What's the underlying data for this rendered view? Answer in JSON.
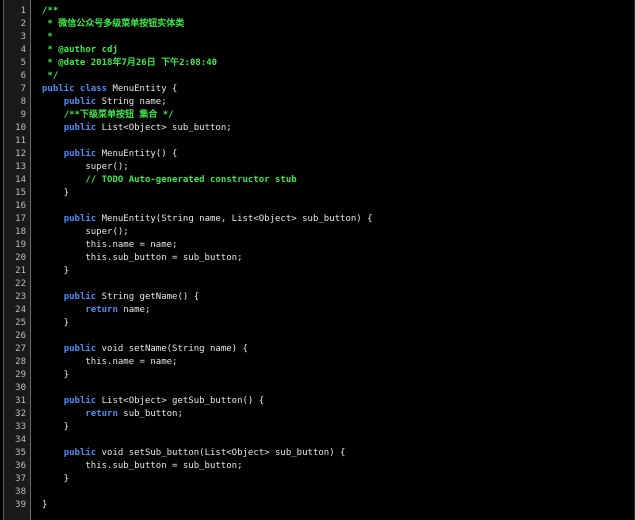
{
  "editor": {
    "language": "java",
    "colors": {
      "background": "#000000",
      "gutter": "#1a1a1a",
      "line_number": "#bdbdbd",
      "comment": "#3ee84a",
      "keyword": "#4b8cf5",
      "text": "#e6e6e6"
    },
    "lines": [
      {
        "n": "1",
        "segments": [
          [
            "c",
            "/**"
          ]
        ]
      },
      {
        "n": "2",
        "segments": [
          [
            "c",
            " * 微信公众号多级菜单按钮实体类"
          ]
        ]
      },
      {
        "n": "3",
        "segments": [
          [
            "c",
            " *"
          ]
        ]
      },
      {
        "n": "4",
        "segments": [
          [
            "c",
            " * @author cdj"
          ]
        ]
      },
      {
        "n": "5",
        "segments": [
          [
            "c",
            " * @date 2018年7月26日 下午2:08:40"
          ]
        ]
      },
      {
        "n": "6",
        "segments": [
          [
            "c",
            " */"
          ]
        ]
      },
      {
        "n": "7",
        "segments": [
          [
            "k",
            "public class"
          ],
          [
            "t",
            " MenuEntity {"
          ]
        ]
      },
      {
        "n": "8",
        "segments": [
          [
            "t",
            "    "
          ],
          [
            "k",
            "public"
          ],
          [
            "t",
            " String name;"
          ]
        ]
      },
      {
        "n": "9",
        "segments": [
          [
            "t",
            "    "
          ],
          [
            "c",
            "/**下级菜单按钮 集合 */"
          ]
        ]
      },
      {
        "n": "10",
        "segments": [
          [
            "t",
            "    "
          ],
          [
            "k",
            "public"
          ],
          [
            "t",
            " List<Object> sub_button;"
          ]
        ]
      },
      {
        "n": "11",
        "segments": []
      },
      {
        "n": "12",
        "segments": [
          [
            "t",
            "    "
          ],
          [
            "k",
            "public"
          ],
          [
            "t",
            " MenuEntity() {"
          ]
        ]
      },
      {
        "n": "13",
        "segments": [
          [
            "t",
            "        super();"
          ]
        ]
      },
      {
        "n": "14",
        "segments": [
          [
            "t",
            "        "
          ],
          [
            "c",
            "// TODO Auto-generated constructor stub"
          ]
        ]
      },
      {
        "n": "15",
        "segments": [
          [
            "t",
            "    }"
          ]
        ]
      },
      {
        "n": "16",
        "segments": []
      },
      {
        "n": "17",
        "segments": [
          [
            "t",
            "    "
          ],
          [
            "k",
            "public"
          ],
          [
            "t",
            " MenuEntity(String name, List<Object> sub_button) {"
          ]
        ]
      },
      {
        "n": "18",
        "segments": [
          [
            "t",
            "        super();"
          ]
        ]
      },
      {
        "n": "19",
        "segments": [
          [
            "t",
            "        this.name = name;"
          ]
        ]
      },
      {
        "n": "20",
        "segments": [
          [
            "t",
            "        this.sub_button = sub_button;"
          ]
        ]
      },
      {
        "n": "21",
        "segments": [
          [
            "t",
            "    }"
          ]
        ]
      },
      {
        "n": "22",
        "segments": []
      },
      {
        "n": "23",
        "segments": [
          [
            "t",
            "    "
          ],
          [
            "k",
            "public"
          ],
          [
            "t",
            " String getName() {"
          ]
        ]
      },
      {
        "n": "24",
        "segments": [
          [
            "t",
            "        "
          ],
          [
            "k",
            "return"
          ],
          [
            "t",
            " name;"
          ]
        ]
      },
      {
        "n": "25",
        "segments": [
          [
            "t",
            "    }"
          ]
        ]
      },
      {
        "n": "26",
        "segments": []
      },
      {
        "n": "27",
        "segments": [
          [
            "t",
            "    "
          ],
          [
            "k",
            "public"
          ],
          [
            "t",
            " void setName(String name) {"
          ]
        ]
      },
      {
        "n": "28",
        "segments": [
          [
            "t",
            "        this.name = name;"
          ]
        ]
      },
      {
        "n": "29",
        "segments": [
          [
            "t",
            "    }"
          ]
        ]
      },
      {
        "n": "30",
        "segments": []
      },
      {
        "n": "31",
        "segments": [
          [
            "t",
            "    "
          ],
          [
            "k",
            "public"
          ],
          [
            "t",
            " List<Object> getSub_button() {"
          ]
        ]
      },
      {
        "n": "32",
        "segments": [
          [
            "t",
            "        "
          ],
          [
            "k",
            "return"
          ],
          [
            "t",
            " sub_button;"
          ]
        ]
      },
      {
        "n": "33",
        "segments": [
          [
            "t",
            "    }"
          ]
        ]
      },
      {
        "n": "34",
        "segments": []
      },
      {
        "n": "35",
        "segments": [
          [
            "t",
            "    "
          ],
          [
            "k",
            "public"
          ],
          [
            "t",
            " void setSub_button(List<Object> sub_button) {"
          ]
        ]
      },
      {
        "n": "36",
        "segments": [
          [
            "t",
            "        this.sub_button = sub_button;"
          ]
        ]
      },
      {
        "n": "37",
        "segments": [
          [
            "t",
            "    }"
          ]
        ]
      },
      {
        "n": "38",
        "segments": []
      },
      {
        "n": "39",
        "segments": [
          [
            "t",
            "}"
          ]
        ]
      }
    ]
  }
}
